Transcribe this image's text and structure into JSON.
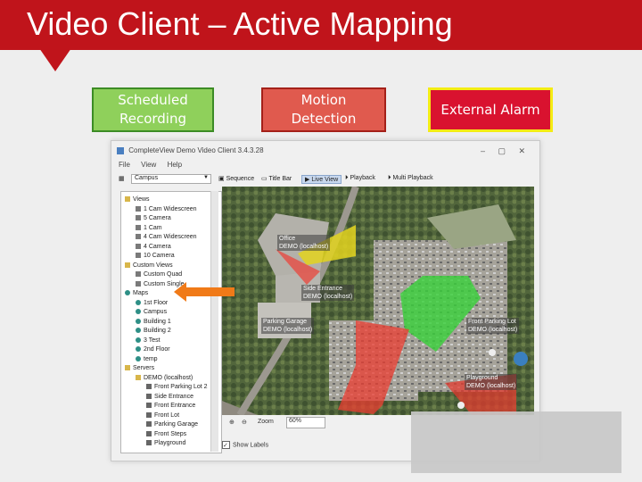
{
  "slide": {
    "title": "Video Client – Active Mapping",
    "legend": {
      "scheduled": "Scheduled\nRecording",
      "motion": "Motion\nDetection",
      "alarm": "External Alarm"
    }
  },
  "colors": {
    "banner": "#c0141b",
    "scheduled": "#8fd05b",
    "motion": "#e05a4e",
    "alarm_border": "#f4ec14"
  },
  "app": {
    "title": "CompleteView Demo Video Client 3.4.3.28",
    "window_controls": "– ▢ ✕",
    "menu": [
      "File",
      "View",
      "Help"
    ],
    "site_combo": "Campus",
    "toolbar": [
      "Sequence",
      "Title Bar",
      "Live View",
      "Playback",
      "Multi Playback"
    ],
    "tree": [
      {
        "label": "Views",
        "icon": "folder-icon",
        "level": 0
      },
      {
        "label": "1 Cam Widescreen",
        "icon": "grid-icon",
        "level": 1
      },
      {
        "label": "5 Camera",
        "icon": "grid-icon",
        "level": 1
      },
      {
        "label": "1 Cam",
        "icon": "grid-icon",
        "level": 1
      },
      {
        "label": "4 Cam Widescreen",
        "icon": "grid-icon",
        "level": 1
      },
      {
        "label": "4 Camera",
        "icon": "grid-icon",
        "level": 1
      },
      {
        "label": "10 Camera",
        "icon": "grid-icon",
        "level": 1
      },
      {
        "label": "Custom Views",
        "icon": "folder-icon",
        "level": 0
      },
      {
        "label": "Custom Quad",
        "icon": "grid-icon",
        "level": 1
      },
      {
        "label": "Custom Single",
        "icon": "grid-icon",
        "level": 1
      },
      {
        "label": "Maps",
        "icon": "globe-icon",
        "level": 0
      },
      {
        "label": "1st Floor",
        "icon": "globe-icon",
        "level": 1
      },
      {
        "label": "Campus",
        "icon": "globe-icon",
        "level": 1
      },
      {
        "label": "Building 1",
        "icon": "globe-icon",
        "level": 1
      },
      {
        "label": "Building 2",
        "icon": "globe-icon",
        "level": 1
      },
      {
        "label": "3 Test",
        "icon": "globe-icon",
        "level": 1
      },
      {
        "label": "2nd Floor",
        "icon": "globe-icon",
        "level": 1
      },
      {
        "label": "temp",
        "icon": "globe-icon",
        "level": 1
      },
      {
        "label": "Servers",
        "icon": "folder-icon",
        "level": 0
      },
      {
        "label": "DEMO (localhost)",
        "icon": "folder-icon",
        "level": 1
      },
      {
        "label": "Front Parking Lot 2",
        "icon": "camera-icon",
        "level": 2
      },
      {
        "label": "Side Entrance",
        "icon": "camera-icon",
        "level": 2
      },
      {
        "label": "Front Entrance",
        "icon": "camera-icon",
        "level": 2
      },
      {
        "label": "Front Lot",
        "icon": "camera-icon",
        "level": 2
      },
      {
        "label": "Parking Garage",
        "icon": "camera-icon",
        "level": 2
      },
      {
        "label": "Front Steps",
        "icon": "camera-icon",
        "level": 2
      },
      {
        "label": "Playground",
        "icon": "camera-icon",
        "level": 2
      }
    ],
    "map_labels": [
      {
        "name": "Office",
        "server": "DEMO (localhost)"
      },
      {
        "name": "Side Entrance",
        "server": "DEMO (localhost)"
      },
      {
        "name": "Parking Garage",
        "server": "DEMO (localhost)"
      },
      {
        "name": "Front Parking Lot",
        "server": "DEMO (localhost)"
      },
      {
        "name": "Playground",
        "server": "DEMO (localhost)"
      }
    ],
    "zoom_label": "Zoom",
    "zoom_value": "60%",
    "show_labels": "Show Labels"
  }
}
